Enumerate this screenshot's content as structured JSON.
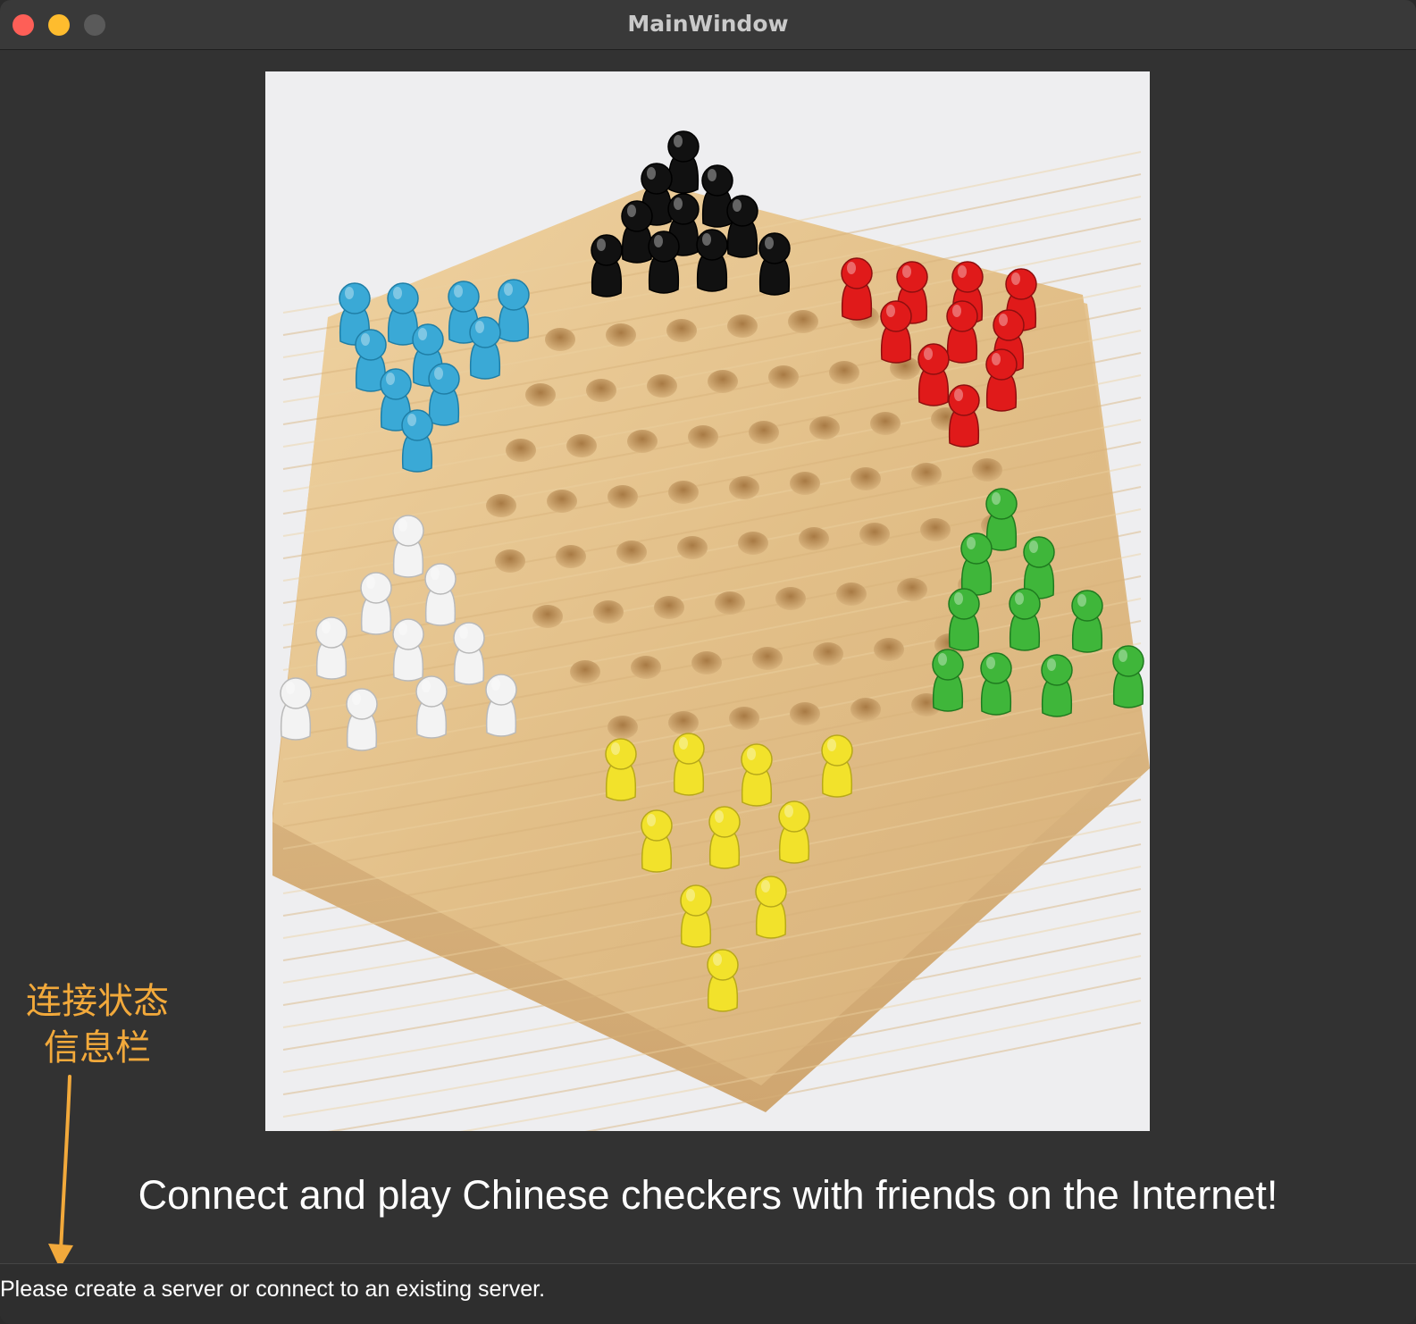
{
  "window": {
    "title": "MainWindow"
  },
  "main": {
    "board_image_alt": "Chinese checkers board with colored pegs",
    "headline": "Connect and play Chinese checkers with friends on the Internet!"
  },
  "statusbar": {
    "message": "Please create a server or connect to an existing server."
  },
  "annotation": {
    "line1": "连接状态",
    "line2": "信息栏"
  },
  "colors": {
    "annotation": "#f2a93b",
    "board_wood": "#e6c490",
    "peg_black": "#111111",
    "peg_red": "#e01a1a",
    "peg_blue": "#3aa9d6",
    "peg_green": "#3fb63a",
    "peg_white": "#f3f3f3",
    "peg_yellow": "#f2e22b"
  }
}
